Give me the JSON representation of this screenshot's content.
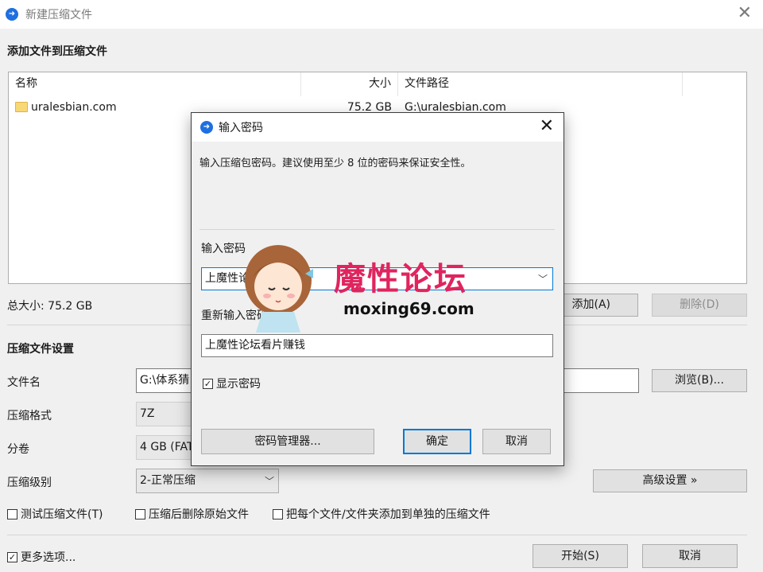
{
  "window": {
    "title": "新建压缩文件",
    "close_glyph": "✕",
    "icon": "app-logo-icon"
  },
  "files_section": {
    "heading": "添加文件到压缩文件",
    "columns": [
      "名称",
      "大小",
      "文件路径"
    ],
    "rows": [
      {
        "name": "uralesbian.com",
        "size": "75.2 GB",
        "path": "G:\\uralesbian.com"
      }
    ],
    "total_label": "总大小: 75.2 GB",
    "add_button": "添加(A)",
    "delete_button": "删除(D)"
  },
  "settings_section": {
    "heading": "压缩文件设置",
    "filename_label": "文件名",
    "filename_value": "G:\\体系猜",
    "browse_button": "浏览(B)...",
    "format_label": "压缩格式",
    "format_value": "7Z",
    "volume_label": "分卷",
    "volume_value": "4 GB (FAT",
    "level_label": "压缩级别",
    "level_value": "2-正常压缩",
    "advanced_button": "高级设置 »",
    "options": [
      {
        "label": "测试压缩文件(T)",
        "checked": false
      },
      {
        "label": "压缩后删除原始文件",
        "checked": false
      },
      {
        "label": "把每个文件/文件夹添加到单独的压缩文件",
        "checked": false
      }
    ]
  },
  "footer": {
    "more_options": {
      "label": "更多选项...",
      "checked": true
    },
    "start_button": "开始(S)",
    "cancel_button": "取消"
  },
  "password_dialog": {
    "title": "输入密码",
    "close_glyph": "✕",
    "description": "输入压缩包密码。建议使用至少 8 位的密码来保证安全性。",
    "password_label": "输入密码",
    "password_value": "上魔性论",
    "reenter_label": "重新输入密码",
    "reenter_value": "上魔性论坛看片赚钱",
    "show_password": {
      "label": "显示密码",
      "checked": true
    },
    "manager_button": "密码管理器...",
    "ok_button": "确定",
    "cancel_button": "取消"
  },
  "watermark": {
    "title": "魔性论坛",
    "url": "moxing69.com"
  }
}
